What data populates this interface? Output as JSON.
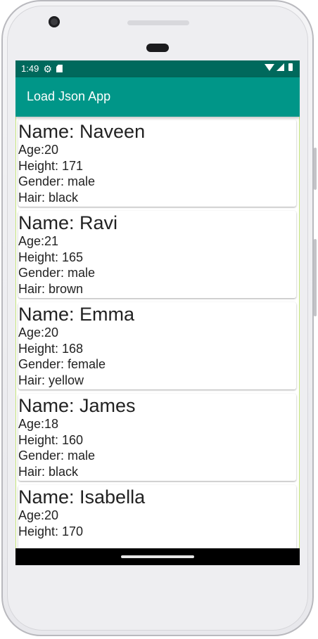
{
  "status_bar": {
    "time": "1:49",
    "icons": [
      "gear-icon",
      "sd-card-icon",
      "wifi-icon",
      "signal-icon",
      "battery-icon"
    ]
  },
  "app_bar": {
    "title": "Load Json App"
  },
  "people": [
    {
      "name": "Name: Naveen",
      "age": "Age:20",
      "height": "Height: 171",
      "gender": "Gender: male",
      "hair": "Hair: black"
    },
    {
      "name": "Name: Ravi",
      "age": "Age:21",
      "height": "Height: 165",
      "gender": "Gender: male",
      "hair": "Hair: brown"
    },
    {
      "name": "Name: Emma",
      "age": "Age:20",
      "height": "Height: 168",
      "gender": "Gender: female",
      "hair": "Hair: yellow"
    },
    {
      "name": "Name: James",
      "age": "Age:18",
      "height": "Height: 160",
      "gender": "Gender: male",
      "hair": "Hair: black"
    },
    {
      "name": "Name: Isabella",
      "age": "Age:20",
      "height": "Height: 170",
      "gender": "",
      "hair": ""
    }
  ],
  "colors": {
    "status_bar": "#00695c",
    "app_bar": "#009688",
    "card_background": "#ffffff",
    "text": "#222222"
  }
}
